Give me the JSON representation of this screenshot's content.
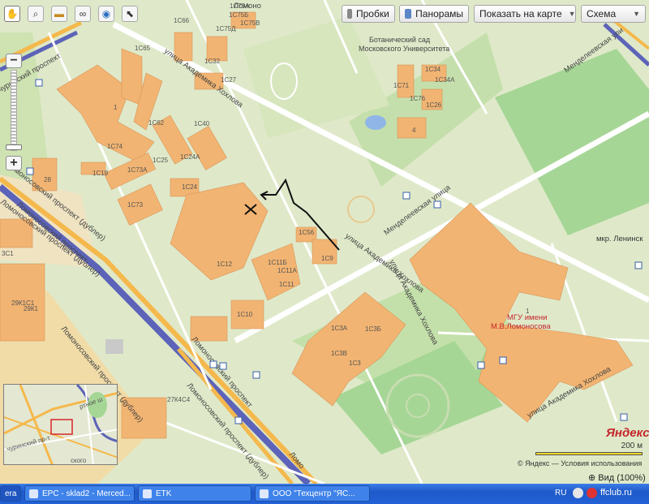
{
  "toolbar": {
    "tools": [
      {
        "name": "hand-icon",
        "glyph": "✋",
        "active": true
      },
      {
        "name": "magnifier-icon",
        "glyph": "🔍"
      },
      {
        "name": "ruler-icon",
        "glyph": "📏"
      },
      {
        "name": "route-icon",
        "glyph": "⚯"
      },
      {
        "name": "camera-icon",
        "glyph": "◉"
      },
      {
        "name": "cursor-icon",
        "glyph": "⬉"
      }
    ],
    "traffic_label": "Пробки",
    "panorama_label": "Панорамы",
    "show_on_map_label": "Показать на карте",
    "map_type_label": "Схема"
  },
  "map": {
    "streets": {
      "akademika_khokhlova_1": "улица Академика Хохлова",
      "akademika_khokhlova_2": "улица Академика Хохлова",
      "akademika_khokhlova_3": "улица Академика Хохлова",
      "akademika_khokhlova_4": "улица Академика Хохлова",
      "mendeleevskaya_1": "Менделеевская улица",
      "mendeleevskaya_2": "Менделеевская ули",
      "lomonosovsky_1": "Ломоносовский проспект",
      "lomonosovsky_2": "Ломоносовский проспект (дублер)",
      "lomonosovsky_3": "Ломоносовский проспект (дублер)",
      "lomonosovsky_4": "Ломоносовский проспект (дублер)",
      "lomonosovsky_5": "Ломоносовский проспект",
      "lomonosovsky_6": "Ломоносовский проспект (дублер)",
      "lomonosovsky_7": "Ломо",
      "lomonosovsky_8": "Ломоно",
      "churinsky": "чуринский проспект",
      "mkr_leninsky": "мкр. Ленинск"
    },
    "botanic_garden": "Ботанический сад\nМосковского Университета",
    "mgu_label": "МГУ имени\nМ.В.Ломоносова",
    "building_labels": [
      "1С75А",
      "1С75Б",
      "1С75В",
      "1С75Д",
      "1С66",
      "1С65",
      "1С32",
      "1С27",
      "1С34",
      "1С34А",
      "1С71",
      "1С76",
      "1С26",
      "1",
      "1С62",
      "1С40",
      "1С74",
      "1С24А",
      "1С25",
      "1С19",
      "1С73А",
      "1С24",
      "1С73",
      "4",
      "1С56",
      "1С9",
      "1С12",
      "1С11Б",
      "1С11А",
      "1С11",
      "1С10",
      "1С3А",
      "1С3Б",
      "1С3В",
      "1С3",
      "28",
      "29К1С1",
      "29К1",
      "3С1",
      "27К4С4",
      "1"
    ]
  },
  "minimap": {
    "labels": [
      "ртное ш",
      "чуринский пр-т",
      "ского"
    ]
  },
  "branding": {
    "logo": "Яндекс",
    "scale_text": "200 м",
    "copyright": "© Яндекс — Условия использования",
    "zoom_status": "Вид (100%)"
  },
  "taskbar": {
    "items": [
      "era",
      "EPC - sklad2 - Merced...",
      "ETK",
      "ООО \"Техцентр \"ЯС..."
    ],
    "lang": "RU",
    "watermark": "ffclub.ru"
  },
  "colors": {
    "ground": "#dfe9c9",
    "building": "#f2b472",
    "highway": "#f5b84c",
    "purple_line": "#5c63b8",
    "road": "#ffffff",
    "park": "#a6d696",
    "taskbar": "#2361d6"
  }
}
